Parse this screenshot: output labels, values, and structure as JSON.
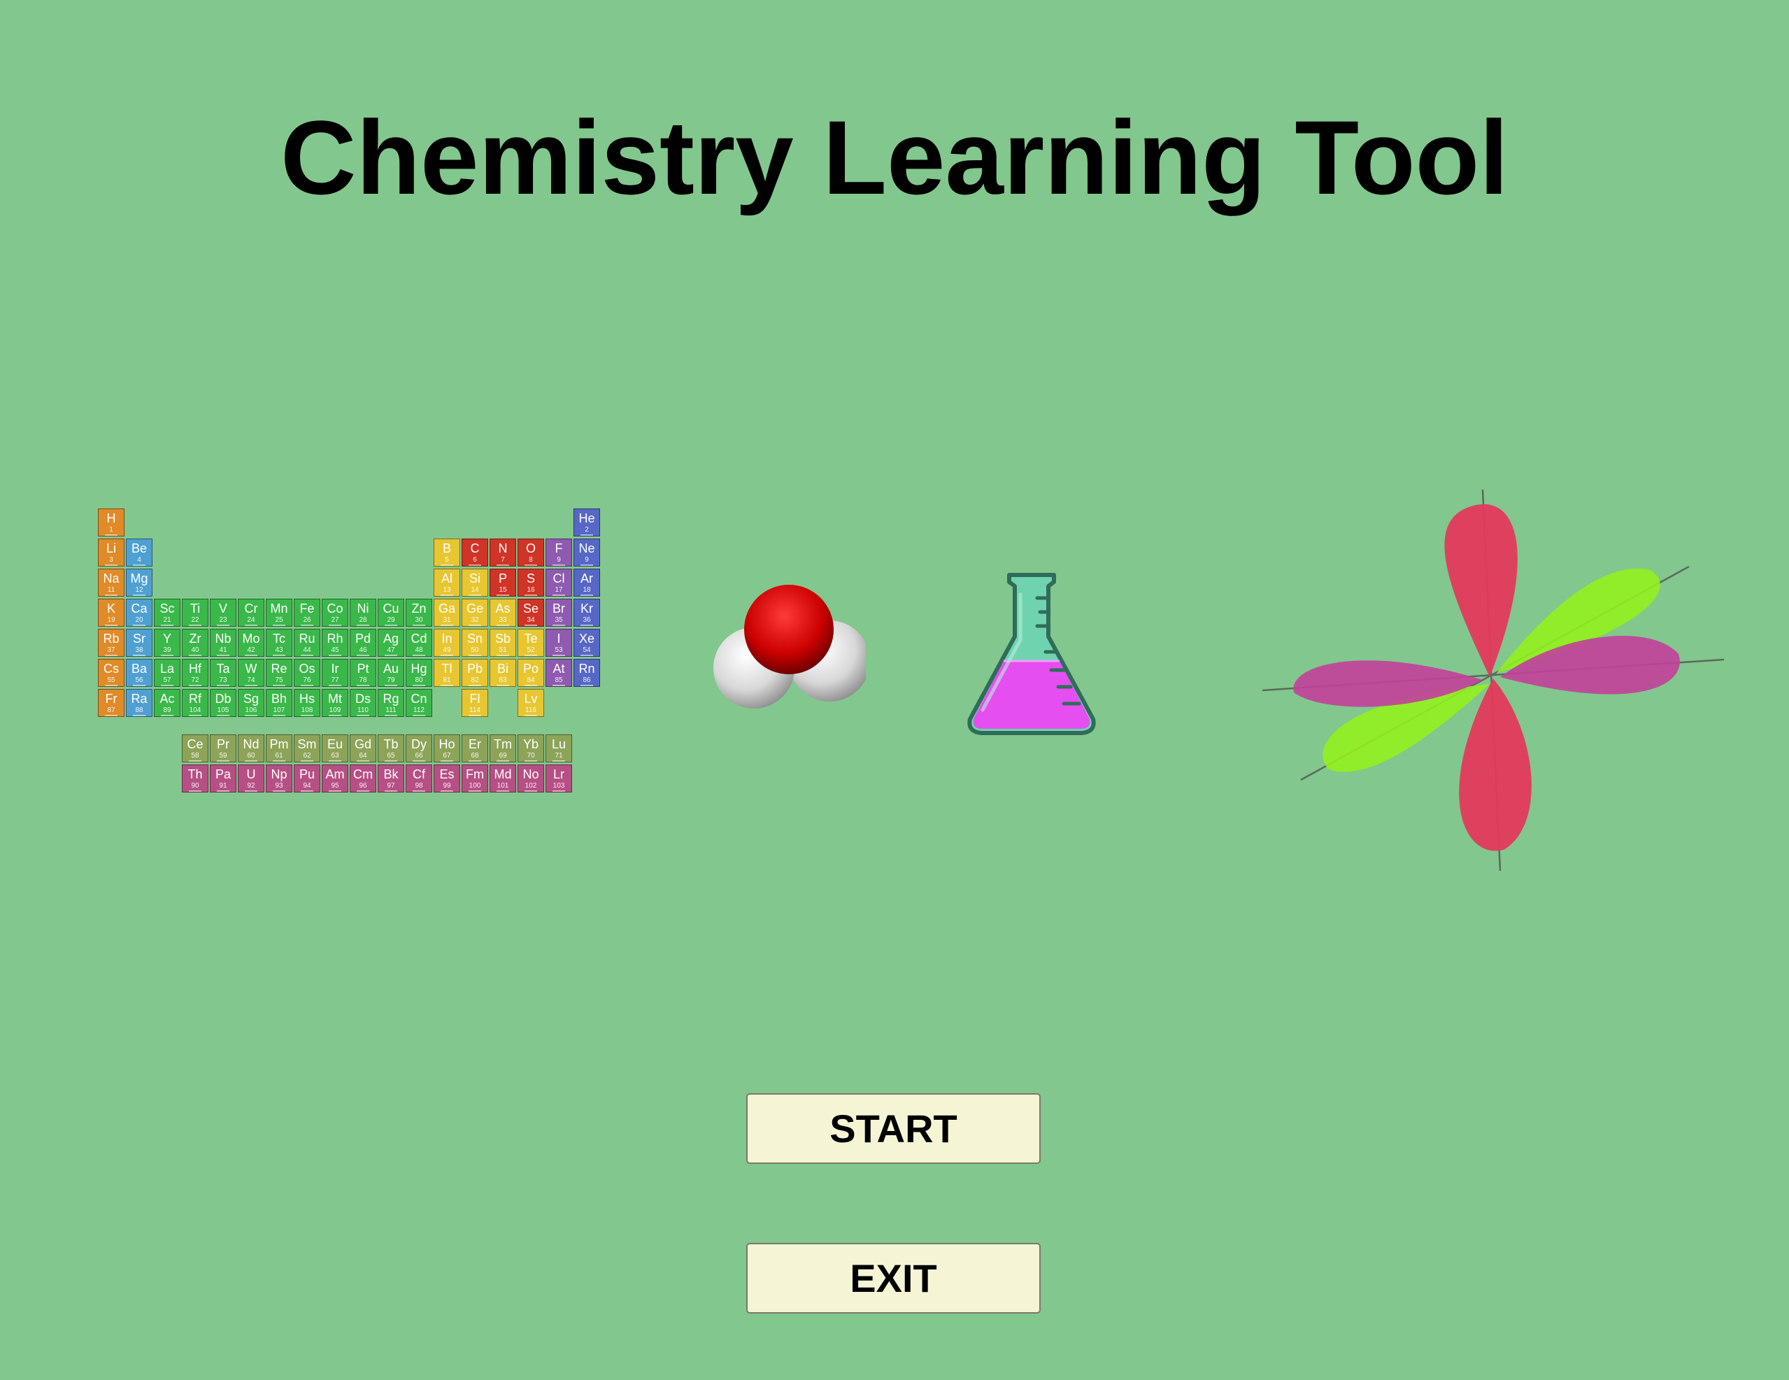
{
  "window": {
    "title": "Chemistry Learning Tool"
  },
  "buttons": {
    "start_label": "START",
    "exit_label": "EXIT"
  },
  "icons": [
    "periodic-table-icon",
    "water-molecule-icon",
    "flask-icon",
    "d-orbital-icon"
  ],
  "periodic_table": {
    "colors": {
      "alkali": "#e08a28",
      "alkaline": "#4fa0d2",
      "transition": "#3bb84a",
      "post": "#e7c631",
      "nonmetal": "#cf3427",
      "halogen": "#8e5bb0",
      "noble": "#5667c6",
      "lanthanide": "#8da458",
      "actinide": "#b65084"
    },
    "main": [
      {
        "s": "H",
        "n": 1,
        "r": 1,
        "c": 1,
        "t": "alkali"
      },
      {
        "s": "He",
        "n": 2,
        "r": 1,
        "c": 18,
        "t": "noble"
      },
      {
        "s": "Li",
        "n": 3,
        "r": 2,
        "c": 1,
        "t": "alkali"
      },
      {
        "s": "Be",
        "n": 4,
        "r": 2,
        "c": 2,
        "t": "alkaline"
      },
      {
        "s": "B",
        "n": 5,
        "r": 2,
        "c": 13,
        "t": "post"
      },
      {
        "s": "C",
        "n": 6,
        "r": 2,
        "c": 14,
        "t": "nonmetal"
      },
      {
        "s": "N",
        "n": 7,
        "r": 2,
        "c": 15,
        "t": "nonmetal"
      },
      {
        "s": "O",
        "n": 8,
        "r": 2,
        "c": 16,
        "t": "nonmetal"
      },
      {
        "s": "F",
        "n": 9,
        "r": 2,
        "c": 17,
        "t": "halogen"
      },
      {
        "s": "Ne",
        "n": 9,
        "r": 2,
        "c": 18,
        "t": "noble"
      },
      {
        "s": "Na",
        "n": 11,
        "r": 3,
        "c": 1,
        "t": "alkali"
      },
      {
        "s": "Mg",
        "n": 12,
        "r": 3,
        "c": 2,
        "t": "alkaline"
      },
      {
        "s": "Al",
        "n": 13,
        "r": 3,
        "c": 13,
        "t": "post"
      },
      {
        "s": "Si",
        "n": 14,
        "r": 3,
        "c": 14,
        "t": "post"
      },
      {
        "s": "P",
        "n": 15,
        "r": 3,
        "c": 15,
        "t": "nonmetal"
      },
      {
        "s": "S",
        "n": 16,
        "r": 3,
        "c": 16,
        "t": "nonmetal"
      },
      {
        "s": "Cl",
        "n": 17,
        "r": 3,
        "c": 17,
        "t": "halogen"
      },
      {
        "s": "Ar",
        "n": 18,
        "r": 3,
        "c": 18,
        "t": "noble"
      },
      {
        "s": "K",
        "n": 19,
        "r": 4,
        "c": 1,
        "t": "alkali"
      },
      {
        "s": "Ca",
        "n": 20,
        "r": 4,
        "c": 2,
        "t": "alkaline"
      },
      {
        "s": "Sc",
        "n": 21,
        "r": 4,
        "c": 3,
        "t": "transition"
      },
      {
        "s": "Ti",
        "n": 22,
        "r": 4,
        "c": 4,
        "t": "transition"
      },
      {
        "s": "V",
        "n": 23,
        "r": 4,
        "c": 5,
        "t": "transition"
      },
      {
        "s": "Cr",
        "n": 24,
        "r": 4,
        "c": 6,
        "t": "transition"
      },
      {
        "s": "Mn",
        "n": 25,
        "r": 4,
        "c": 7,
        "t": "transition"
      },
      {
        "s": "Fe",
        "n": 26,
        "r": 4,
        "c": 8,
        "t": "transition"
      },
      {
        "s": "Co",
        "n": 27,
        "r": 4,
        "c": 9,
        "t": "transition"
      },
      {
        "s": "Ni",
        "n": 28,
        "r": 4,
        "c": 10,
        "t": "transition"
      },
      {
        "s": "Cu",
        "n": 29,
        "r": 4,
        "c": 11,
        "t": "transition"
      },
      {
        "s": "Zn",
        "n": 30,
        "r": 4,
        "c": 12,
        "t": "transition"
      },
      {
        "s": "Ga",
        "n": 31,
        "r": 4,
        "c": 13,
        "t": "post"
      },
      {
        "s": "Ge",
        "n": 32,
        "r": 4,
        "c": 14,
        "t": "post"
      },
      {
        "s": "As",
        "n": 33,
        "r": 4,
        "c": 15,
        "t": "post"
      },
      {
        "s": "Se",
        "n": 34,
        "r": 4,
        "c": 16,
        "t": "nonmetal"
      },
      {
        "s": "Br",
        "n": 35,
        "r": 4,
        "c": 17,
        "t": "halogen"
      },
      {
        "s": "Kr",
        "n": 36,
        "r": 4,
        "c": 18,
        "t": "noble"
      },
      {
        "s": "Rb",
        "n": 37,
        "r": 5,
        "c": 1,
        "t": "alkali"
      },
      {
        "s": "Sr",
        "n": 38,
        "r": 5,
        "c": 2,
        "t": "alkaline"
      },
      {
        "s": "Y",
        "n": 39,
        "r": 5,
        "c": 3,
        "t": "transition"
      },
      {
        "s": "Zr",
        "n": 40,
        "r": 5,
        "c": 4,
        "t": "transition"
      },
      {
        "s": "Nb",
        "n": 41,
        "r": 5,
        "c": 5,
        "t": "transition"
      },
      {
        "s": "Mo",
        "n": 42,
        "r": 5,
        "c": 6,
        "t": "transition"
      },
      {
        "s": "Tc",
        "n": 43,
        "r": 5,
        "c": 7,
        "t": "transition"
      },
      {
        "s": "Ru",
        "n": 44,
        "r": 5,
        "c": 8,
        "t": "transition"
      },
      {
        "s": "Rh",
        "n": 45,
        "r": 5,
        "c": 9,
        "t": "transition"
      },
      {
        "s": "Pd",
        "n": 46,
        "r": 5,
        "c": 10,
        "t": "transition"
      },
      {
        "s": "Ag",
        "n": 47,
        "r": 5,
        "c": 11,
        "t": "transition"
      },
      {
        "s": "Cd",
        "n": 48,
        "r": 5,
        "c": 12,
        "t": "transition"
      },
      {
        "s": "In",
        "n": 49,
        "r": 5,
        "c": 13,
        "t": "post"
      },
      {
        "s": "Sn",
        "n": 50,
        "r": 5,
        "c": 14,
        "t": "post"
      },
      {
        "s": "Sb",
        "n": 51,
        "r": 5,
        "c": 15,
        "t": "post"
      },
      {
        "s": "Te",
        "n": 52,
        "r": 5,
        "c": 16,
        "t": "post"
      },
      {
        "s": "I",
        "n": 53,
        "r": 5,
        "c": 17,
        "t": "halogen"
      },
      {
        "s": "Xe",
        "n": 54,
        "r": 5,
        "c": 18,
        "t": "noble"
      },
      {
        "s": "Cs",
        "n": 55,
        "r": 6,
        "c": 1,
        "t": "alkali"
      },
      {
        "s": "Ba",
        "n": 56,
        "r": 6,
        "c": 2,
        "t": "alkaline"
      },
      {
        "s": "La",
        "n": 57,
        "r": 6,
        "c": 3,
        "t": "transition"
      },
      {
        "s": "Hf",
        "n": 72,
        "r": 6,
        "c": 4,
        "t": "transition"
      },
      {
        "s": "Ta",
        "n": 73,
        "r": 6,
        "c": 5,
        "t": "transition"
      },
      {
        "s": "W",
        "n": 74,
        "r": 6,
        "c": 6,
        "t": "transition"
      },
      {
        "s": "Re",
        "n": 75,
        "r": 6,
        "c": 7,
        "t": "transition"
      },
      {
        "s": "Os",
        "n": 76,
        "r": 6,
        "c": 8,
        "t": "transition"
      },
      {
        "s": "Ir",
        "n": 77,
        "r": 6,
        "c": 9,
        "t": "transition"
      },
      {
        "s": "Pt",
        "n": 78,
        "r": 6,
        "c": 10,
        "t": "transition"
      },
      {
        "s": "Au",
        "n": 79,
        "r": 6,
        "c": 11,
        "t": "transition"
      },
      {
        "s": "Hg",
        "n": 80,
        "r": 6,
        "c": 12,
        "t": "transition"
      },
      {
        "s": "Tl",
        "n": 81,
        "r": 6,
        "c": 13,
        "t": "post"
      },
      {
        "s": "Pb",
        "n": 82,
        "r": 6,
        "c": 14,
        "t": "post"
      },
      {
        "s": "Bi",
        "n": 83,
        "r": 6,
        "c": 15,
        "t": "post"
      },
      {
        "s": "Po",
        "n": 84,
        "r": 6,
        "c": 16,
        "t": "post"
      },
      {
        "s": "At",
        "n": 85,
        "r": 6,
        "c": 17,
        "t": "halogen"
      },
      {
        "s": "Rn",
        "n": 86,
        "r": 6,
        "c": 18,
        "t": "noble"
      },
      {
        "s": "Fr",
        "n": 87,
        "r": 7,
        "c": 1,
        "t": "alkali"
      },
      {
        "s": "Ra",
        "n": 88,
        "r": 7,
        "c": 2,
        "t": "alkaline"
      },
      {
        "s": "Ac",
        "n": 89,
        "r": 7,
        "c": 3,
        "t": "transition"
      },
      {
        "s": "Rf",
        "n": 104,
        "r": 7,
        "c": 4,
        "t": "transition"
      },
      {
        "s": "Db",
        "n": 105,
        "r": 7,
        "c": 5,
        "t": "transition"
      },
      {
        "s": "Sg",
        "n": 106,
        "r": 7,
        "c": 6,
        "t": "transition"
      },
      {
        "s": "Bh",
        "n": 107,
        "r": 7,
        "c": 7,
        "t": "transition"
      },
      {
        "s": "Hs",
        "n": 108,
        "r": 7,
        "c": 8,
        "t": "transition"
      },
      {
        "s": "Mt",
        "n": 109,
        "r": 7,
        "c": 9,
        "t": "transition"
      },
      {
        "s": "Ds",
        "n": 110,
        "r": 7,
        "c": 10,
        "t": "transition"
      },
      {
        "s": "Rg",
        "n": 111,
        "r": 7,
        "c": 11,
        "t": "transition"
      },
      {
        "s": "Cn",
        "n": 112,
        "r": 7,
        "c": 12,
        "t": "transition"
      },
      {
        "s": "Fl",
        "n": 114,
        "r": 7,
        "c": 14,
        "t": "post"
      },
      {
        "s": "Lv",
        "n": 116,
        "r": 7,
        "c": 16,
        "t": "post"
      }
    ],
    "lanthanides": [
      {
        "s": "Ce",
        "n": 58
      },
      {
        "s": "Pr",
        "n": 59
      },
      {
        "s": "Nd",
        "n": 60
      },
      {
        "s": "Pm",
        "n": 61
      },
      {
        "s": "Sm",
        "n": 62
      },
      {
        "s": "Eu",
        "n": 63
      },
      {
        "s": "Gd",
        "n": 64
      },
      {
        "s": "Tb",
        "n": 65
      },
      {
        "s": "Dy",
        "n": 66
      },
      {
        "s": "Ho",
        "n": 67
      },
      {
        "s": "Er",
        "n": 68
      },
      {
        "s": "Tm",
        "n": 69
      },
      {
        "s": "Yb",
        "n": 70
      },
      {
        "s": "Lu",
        "n": 71
      }
    ],
    "actinides": [
      {
        "s": "Th",
        "n": 90
      },
      {
        "s": "Pa",
        "n": 91
      },
      {
        "s": "U",
        "n": 92
      },
      {
        "s": "Np",
        "n": 93
      },
      {
        "s": "Pu",
        "n": 94
      },
      {
        "s": "Am",
        "n": 95
      },
      {
        "s": "Cm",
        "n": 96
      },
      {
        "s": "Bk",
        "n": 97
      },
      {
        "s": "Cf",
        "n": 98
      },
      {
        "s": "Es",
        "n": 99
      },
      {
        "s": "Fm",
        "n": 100
      },
      {
        "s": "Md",
        "n": 101
      },
      {
        "s": "No",
        "n": 102
      },
      {
        "s": "Lr",
        "n": 103
      }
    ]
  },
  "colors": {
    "background": "#82c78d",
    "button_bg": "#f5f5d6",
    "flask_glass": "#6fd3b0",
    "flask_liquid": "#e54ef0",
    "orbital_red": "#e33a5c",
    "orbital_green": "#92ef1e",
    "orbital_magenta": "#c2409a"
  }
}
